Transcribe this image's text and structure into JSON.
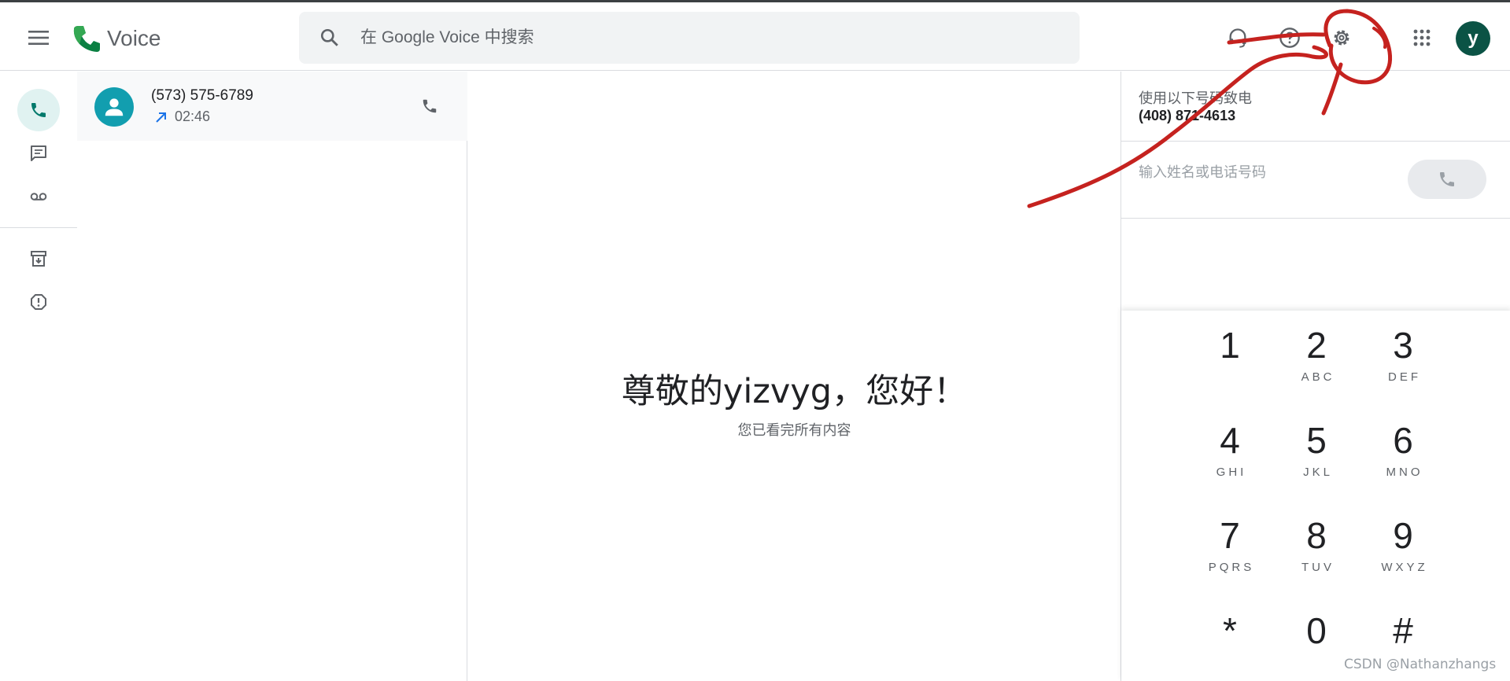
{
  "app": {
    "name": "Voice"
  },
  "search": {
    "placeholder": "在 Google Voice 中搜索"
  },
  "header": {
    "avatar_letter": "y"
  },
  "calls": [
    {
      "number": "(573) 575-6789",
      "duration": "02:46",
      "direction": "outgoing"
    }
  ],
  "main": {
    "greeting": "尊敬的yizvyg，您好！",
    "subtitle": "您已看完所有内容"
  },
  "dialer": {
    "caller_label": "使用以下号码致电",
    "caller_number": "(408) 871-4613",
    "input_placeholder": "输入姓名或电话号码",
    "keys": [
      {
        "digit": "1",
        "letters": ""
      },
      {
        "digit": "2",
        "letters": "ABC"
      },
      {
        "digit": "3",
        "letters": "DEF"
      },
      {
        "digit": "4",
        "letters": "GHI"
      },
      {
        "digit": "5",
        "letters": "JKL"
      },
      {
        "digit": "6",
        "letters": "MNO"
      },
      {
        "digit": "7",
        "letters": "PQRS"
      },
      {
        "digit": "8",
        "letters": "TUV"
      },
      {
        "digit": "9",
        "letters": "WXYZ"
      },
      {
        "digit": "*",
        "letters": ""
      },
      {
        "digit": "0",
        "letters": ""
      },
      {
        "digit": "#",
        "letters": ""
      }
    ]
  },
  "watermark": "CSDN @Nathanzhangs",
  "colors": {
    "accent": "#0b8043",
    "avatar": "#0b5345",
    "contact_avatar": "#129eaf",
    "annotation": "#c5221f"
  }
}
